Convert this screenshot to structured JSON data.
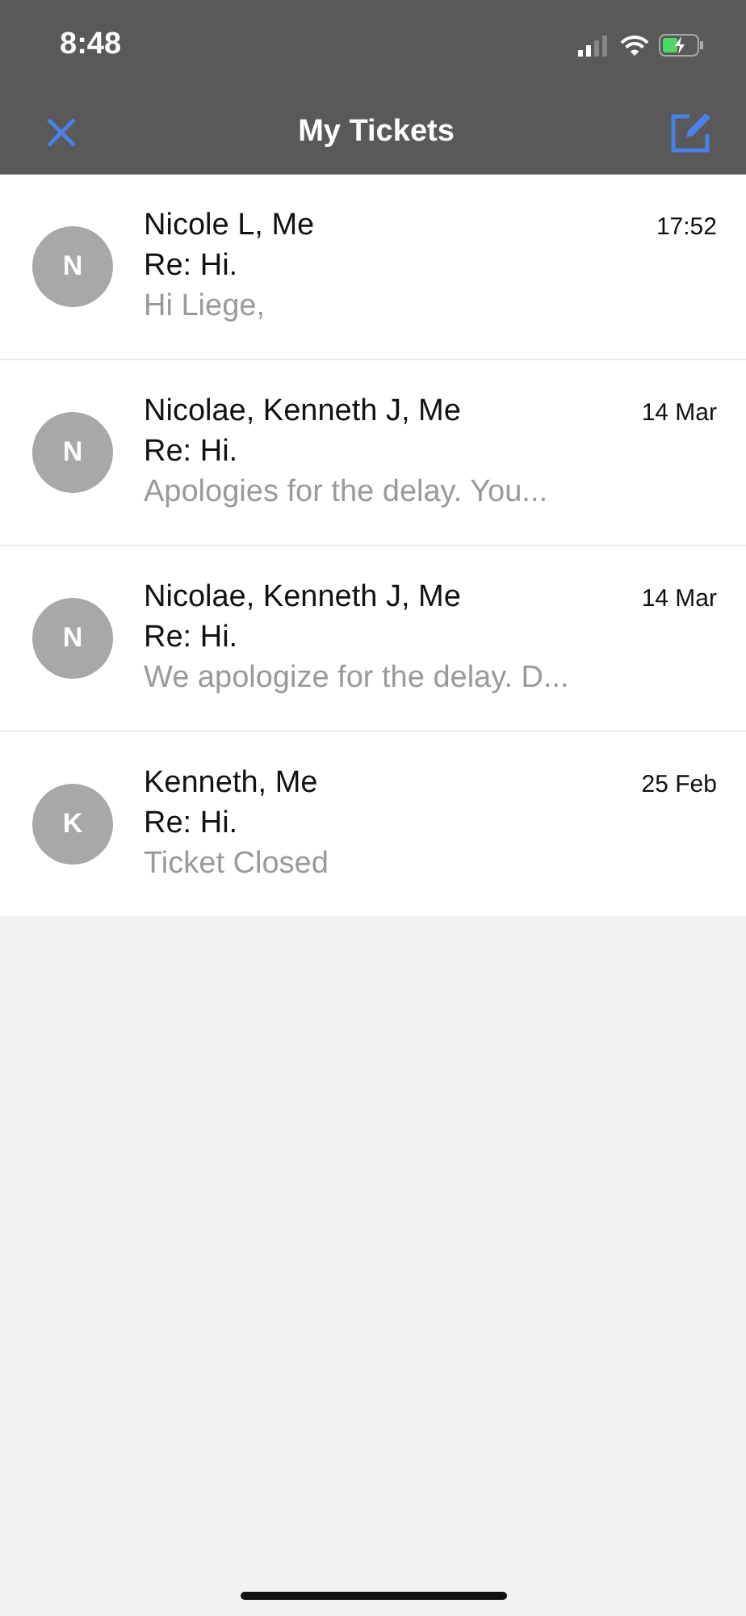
{
  "status_bar": {
    "time": "8:48"
  },
  "nav": {
    "title": "My Tickets"
  },
  "tickets": [
    {
      "initial": "N",
      "participants": "Nicole L, Me",
      "date": "17:52",
      "subject": "Re: Hi.",
      "preview": "Hi Liege,"
    },
    {
      "initial": "N",
      "participants": "Nicolae, Kenneth J, Me",
      "date": "14 Mar",
      "subject": "Re: Hi.",
      "preview": "Apologies for the delay. You..."
    },
    {
      "initial": "N",
      "participants": "Nicolae, Kenneth J, Me",
      "date": "14 Mar",
      "subject": "Re: Hi.",
      "preview": "We apologize for the delay. D..."
    },
    {
      "initial": "K",
      "participants": "Kenneth, Me",
      "date": "25 Feb",
      "subject": "Re: Hi.",
      "preview": "Ticket Closed"
    }
  ]
}
